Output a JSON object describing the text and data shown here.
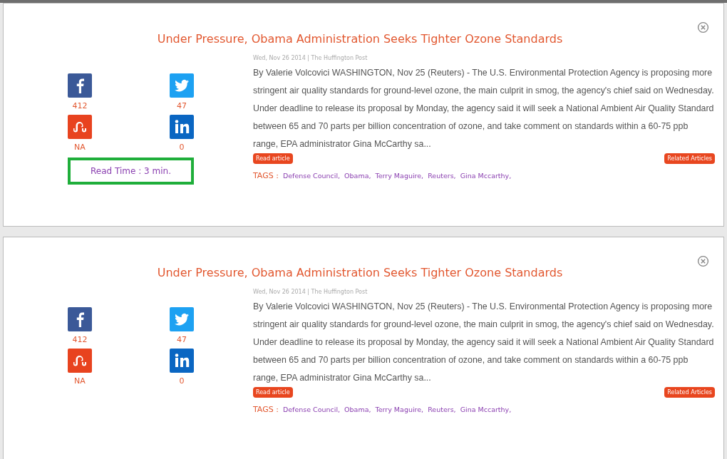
{
  "articles": [
    {
      "title": "Under Pressure, Obama Administration Seeks Tighter Ozone Standards",
      "meta": "Wed, Nov 26 2014 | The Huffington Post",
      "body": "By Valerie Volcovici WASHINGTON, Nov 25 (Reuters) - The U.S. Environmental Protection Agency is proposing more stringent air quality standards for ground-level ozone, the main culprit in smog, the agency's chief said on Wednesday. Under deadline to release its proposal by Monday, the agency said it will seek a National Ambient Air Quality Standard between 65 and 70 parts per billion concentration of ozone, and take comment on standards within a 60-75 ppb range, EPA administrator Gina McCarthy sa...",
      "shares": [
        {
          "kind": "facebook",
          "count": "412"
        },
        {
          "kind": "twitter",
          "count": "47"
        },
        {
          "kind": "stumbleupon",
          "count": "NA"
        },
        {
          "kind": "linkedin",
          "count": "0"
        }
      ],
      "read_time": "Read Time : 3 min.",
      "read_button": "Read article",
      "related_button": "Related Articles",
      "tags_label": "TAGS :",
      "tags": [
        "Defense Council,",
        "Obama,",
        "Terry Maguire,",
        "Reuters,",
        "Gina Mccarthy,"
      ]
    },
    {
      "title": "Under Pressure, Obama Administration Seeks Tighter Ozone Standards",
      "meta": "Wed, Nov 26 2014 | The Huffington Post",
      "body": "By Valerie Volcovici WASHINGTON, Nov 25 (Reuters) - The U.S. Environmental Protection Agency is proposing more stringent air quality standards for ground-level ozone, the main culprit in smog, the agency's chief said on Wednesday. Under deadline to release its proposal by Monday, the agency said it will seek a National Ambient Air Quality Standard between 65 and 70 parts per billion concentration of ozone, and take comment on standards within a 60-75 ppb range, EPA administrator Gina McCarthy sa...",
      "shares": [
        {
          "kind": "facebook",
          "count": "412"
        },
        {
          "kind": "twitter",
          "count": "47"
        },
        {
          "kind": "stumbleupon",
          "count": "NA"
        },
        {
          "kind": "linkedin",
          "count": "0"
        }
      ],
      "read_button": "Read article",
      "related_button": "Related Articles",
      "tags_label": "TAGS :",
      "tags": [
        "Defense Council,",
        "Obama,",
        "Terry Maguire,",
        "Reuters,",
        "Gina Mccarthy,"
      ]
    }
  ]
}
